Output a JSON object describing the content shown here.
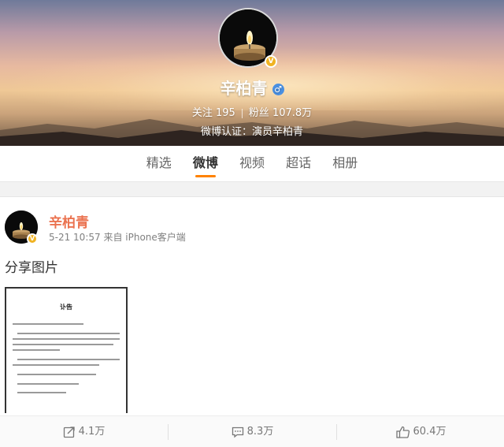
{
  "profile": {
    "name": "辛柏青",
    "gender_symbol": "♂",
    "verified_badge": "V",
    "following_label": "关注",
    "following_count": "195",
    "followers_label": "粉丝",
    "followers_count": "107.8万",
    "verification": "微博认证：演员辛柏青"
  },
  "tabs": [
    {
      "label": "精选"
    },
    {
      "label": "微博",
      "active": true
    },
    {
      "label": "视频"
    },
    {
      "label": "超话"
    },
    {
      "label": "相册"
    }
  ],
  "post": {
    "author": "辛柏青",
    "time": "5-21 10:57",
    "source": "来自 iPhone客户端",
    "text": "分享图片",
    "image_title": "讣告"
  },
  "actions": {
    "repost_count": "4.1万",
    "comment_count": "8.3万",
    "like_count": "60.4万"
  },
  "colors": {
    "accent": "#ff8200",
    "author_name": "#eb7350",
    "verified_badge": "#f0b323",
    "gender_badge": "#4a90e2"
  }
}
